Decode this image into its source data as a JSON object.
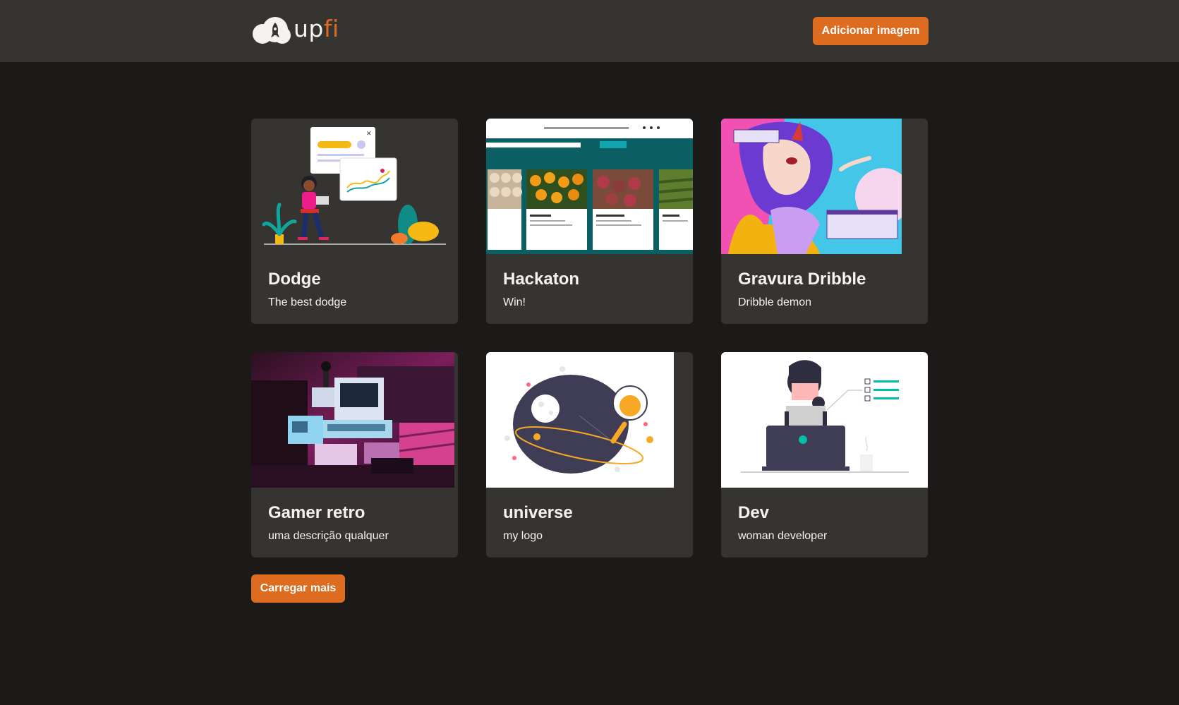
{
  "header": {
    "logo": {
      "prefix": "up",
      "accent": "fi"
    },
    "add_button_label": "Adicionar imagem"
  },
  "cards": [
    {
      "title": "Dodge",
      "description": "The best dodge",
      "image": "dashboard-illustration"
    },
    {
      "title": "Hackaton",
      "description": "Win!",
      "image": "website-screenshot"
    },
    {
      "title": "Gravura Dribble",
      "description": "Dribble demon",
      "image": "anime-illustration"
    },
    {
      "title": "Gamer retro",
      "description": "uma descrição qualquer",
      "image": "retro-computers-photo"
    },
    {
      "title": "universe",
      "description": "my logo",
      "image": "universe-illustration"
    },
    {
      "title": "Dev",
      "description": "woman developer",
      "image": "developer-illustration"
    }
  ],
  "load_more_label": "Carregar mais",
  "colors": {
    "accent": "#dd6b20",
    "header_bg": "#353431",
    "page_bg": "#1b1a19",
    "card_bg": "#353431"
  }
}
